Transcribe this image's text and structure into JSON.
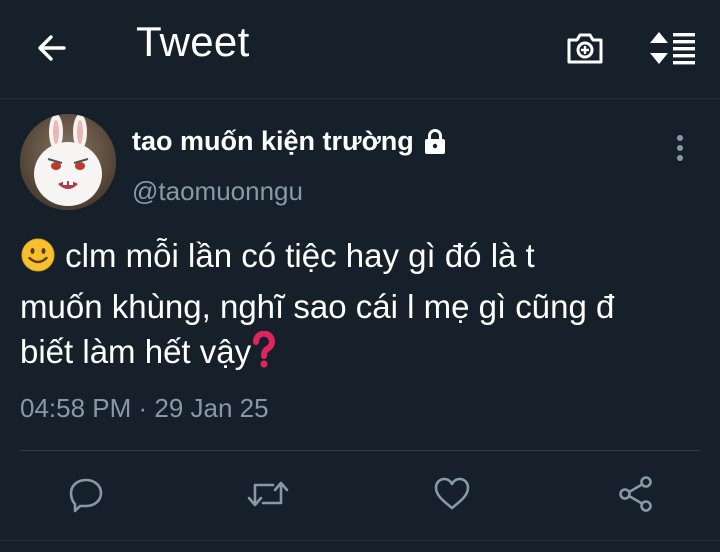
{
  "header": {
    "title": "Tweet",
    "icons": {
      "back": "arrow-left-icon",
      "camera": "camera-icon",
      "sort": "sort-icon"
    }
  },
  "tweet": {
    "display_name": "tao muốn kiện trường",
    "handle": "@taomuonngu",
    "text_lines": [
      "clm mỗi lần có tiệc hay gì đó là t",
      "muốn khùng, nghĩ sao cái l mẹ gì cũng đ",
      "biết làm hết vậy"
    ],
    "timestamp": "04:58 PM · 29 Jan 25",
    "protected": true
  },
  "actions": [
    "reply-icon",
    "retweet-icon",
    "like-icon",
    "share-icon"
  ],
  "colors": {
    "background": "#15202b",
    "secondary_text": "#8899a6",
    "accent_red": "#e0245e"
  }
}
